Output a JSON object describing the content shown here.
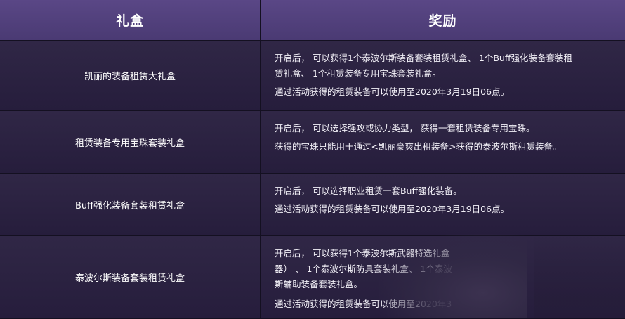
{
  "header": {
    "col_box": "礼盒",
    "col_reward": "奖励"
  },
  "rows": [
    {
      "name": "凯丽的装备租赁大礼盒",
      "desc": [
        "开启后， 可以获得1个泰波尔斯装备套装租赁礼盒、 1个Buff强化装备套装租",
        "赁礼盒、 1个租赁装备专用宝珠套装礼盒。"
      ],
      "note": "通过活动获得的租赁装备可以使用至2020年3月19日06点。"
    },
    {
      "name": "租赁装备专用宝珠套装礼盒",
      "desc": [
        "开启后， 可以选择强攻或协力类型， 获得一套租赁装备专用宝珠。"
      ],
      "note": "获得的宝珠只能用于通过<凯丽豪爽出租装备>获得的泰波尔斯租赁装备。"
    },
    {
      "name": "Buff强化装备套装租赁礼盒",
      "desc": [
        "开启后， 可以选择职业租赁一套Buff强化装备。"
      ],
      "note": "通过活动获得的租赁装备可以使用至2020年3月19日06点。"
    },
    {
      "name": "泰波尔斯装备套装租赁礼盒",
      "desc": [
        "开启后， 可以获得1个泰波尔斯武器特选礼盒",
        "器） 、 1个泰波尔斯防具套装礼盒、 1个泰波",
        "斯辅助装备套装礼盒。"
      ],
      "note": "通过活动获得的租赁装备可以使用至2020年3"
    }
  ]
}
